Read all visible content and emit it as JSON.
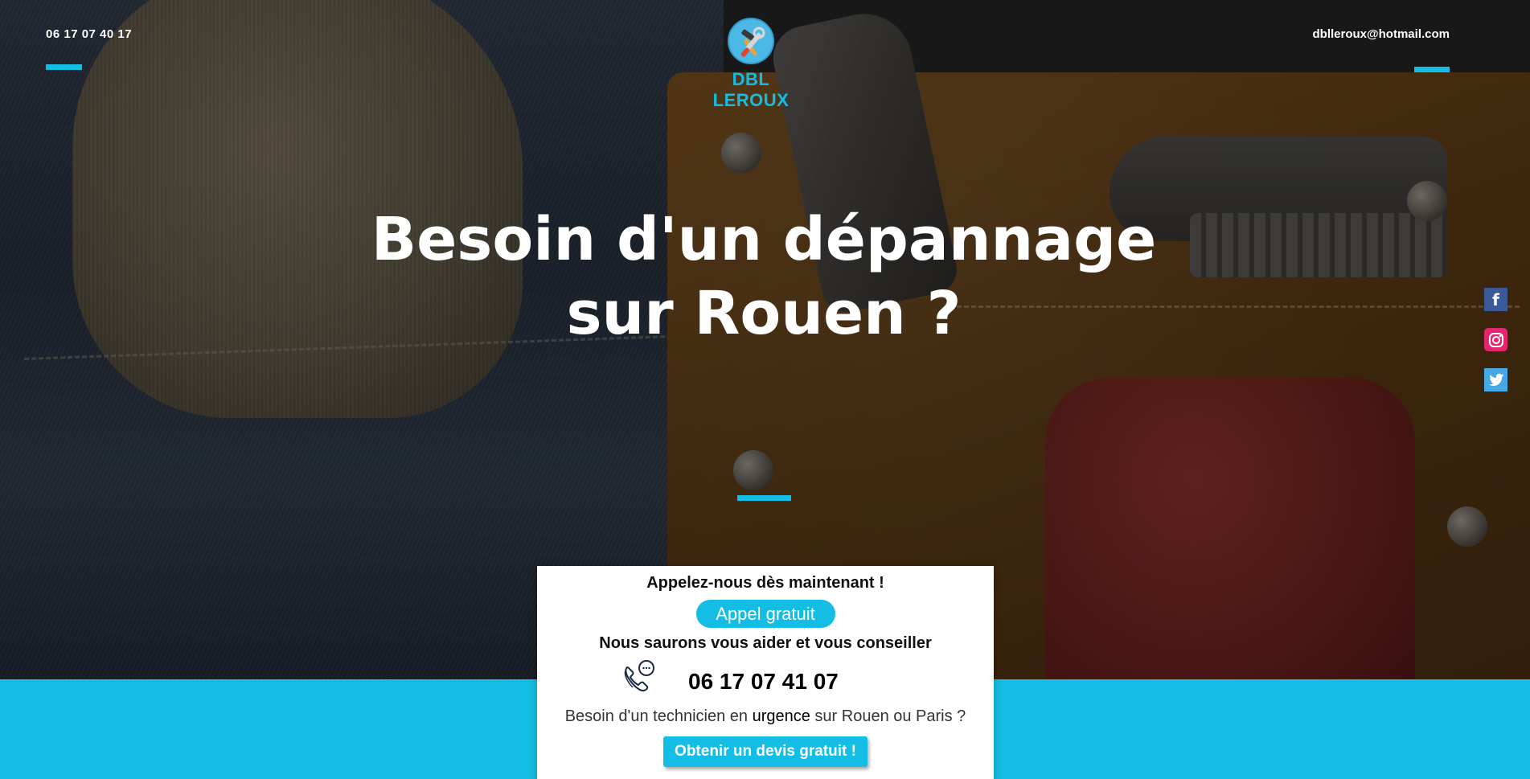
{
  "header": {
    "phone": "06 17 07 40 17",
    "email": "dblleroux@hotmail.com",
    "brand": "DBL LEROUX"
  },
  "hero": {
    "headline_line1": "Besoin d'un dépannage",
    "headline_line2": "sur Rouen  ?"
  },
  "social": {
    "icons": [
      "facebook-icon",
      "instagram-icon",
      "twitter-icon"
    ]
  },
  "card": {
    "call_now": "Appelez-nous dès maintenant !",
    "free_call_label": "Appel gratuit",
    "help_text": "Nous saurons vous aider et vous conseiller",
    "phone": "06 17 07 41 07",
    "urgent_prefix": "Besoin d'un technicien en ",
    "urgent_word": "urgence",
    "urgent_suffix": " sur Rouen ou Paris ?",
    "quote_button": "Obtenir un devis gratuit !"
  },
  "colors": {
    "accent": "#13bde3",
    "facebook": "#3b5998",
    "instagram": "#e4266e",
    "twitter": "#47a8e6"
  }
}
